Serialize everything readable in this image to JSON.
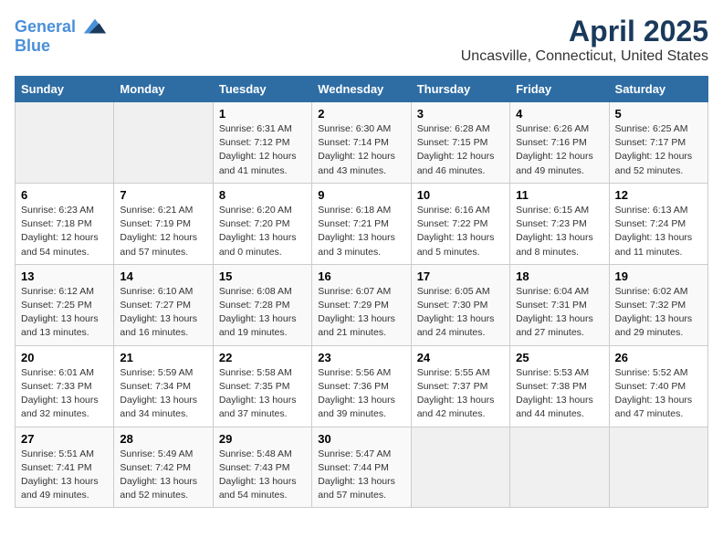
{
  "header": {
    "logo_line1": "General",
    "logo_line2": "Blue",
    "title": "April 2025",
    "subtitle": "Uncasville, Connecticut, United States"
  },
  "days_of_week": [
    "Sunday",
    "Monday",
    "Tuesday",
    "Wednesday",
    "Thursday",
    "Friday",
    "Saturday"
  ],
  "weeks": [
    [
      {
        "day": "",
        "empty": true
      },
      {
        "day": "",
        "empty": true
      },
      {
        "day": "1",
        "sunrise": "6:31 AM",
        "sunset": "7:12 PM",
        "daylight": "12 hours and 41 minutes."
      },
      {
        "day": "2",
        "sunrise": "6:30 AM",
        "sunset": "7:14 PM",
        "daylight": "12 hours and 43 minutes."
      },
      {
        "day": "3",
        "sunrise": "6:28 AM",
        "sunset": "7:15 PM",
        "daylight": "12 hours and 46 minutes."
      },
      {
        "day": "4",
        "sunrise": "6:26 AM",
        "sunset": "7:16 PM",
        "daylight": "12 hours and 49 minutes."
      },
      {
        "day": "5",
        "sunrise": "6:25 AM",
        "sunset": "7:17 PM",
        "daylight": "12 hours and 52 minutes."
      }
    ],
    [
      {
        "day": "6",
        "sunrise": "6:23 AM",
        "sunset": "7:18 PM",
        "daylight": "12 hours and 54 minutes."
      },
      {
        "day": "7",
        "sunrise": "6:21 AM",
        "sunset": "7:19 PM",
        "daylight": "12 hours and 57 minutes."
      },
      {
        "day": "8",
        "sunrise": "6:20 AM",
        "sunset": "7:20 PM",
        "daylight": "13 hours and 0 minutes."
      },
      {
        "day": "9",
        "sunrise": "6:18 AM",
        "sunset": "7:21 PM",
        "daylight": "13 hours and 3 minutes."
      },
      {
        "day": "10",
        "sunrise": "6:16 AM",
        "sunset": "7:22 PM",
        "daylight": "13 hours and 5 minutes."
      },
      {
        "day": "11",
        "sunrise": "6:15 AM",
        "sunset": "7:23 PM",
        "daylight": "13 hours and 8 minutes."
      },
      {
        "day": "12",
        "sunrise": "6:13 AM",
        "sunset": "7:24 PM",
        "daylight": "13 hours and 11 minutes."
      }
    ],
    [
      {
        "day": "13",
        "sunrise": "6:12 AM",
        "sunset": "7:25 PM",
        "daylight": "13 hours and 13 minutes."
      },
      {
        "day": "14",
        "sunrise": "6:10 AM",
        "sunset": "7:27 PM",
        "daylight": "13 hours and 16 minutes."
      },
      {
        "day": "15",
        "sunrise": "6:08 AM",
        "sunset": "7:28 PM",
        "daylight": "13 hours and 19 minutes."
      },
      {
        "day": "16",
        "sunrise": "6:07 AM",
        "sunset": "7:29 PM",
        "daylight": "13 hours and 21 minutes."
      },
      {
        "day": "17",
        "sunrise": "6:05 AM",
        "sunset": "7:30 PM",
        "daylight": "13 hours and 24 minutes."
      },
      {
        "day": "18",
        "sunrise": "6:04 AM",
        "sunset": "7:31 PM",
        "daylight": "13 hours and 27 minutes."
      },
      {
        "day": "19",
        "sunrise": "6:02 AM",
        "sunset": "7:32 PM",
        "daylight": "13 hours and 29 minutes."
      }
    ],
    [
      {
        "day": "20",
        "sunrise": "6:01 AM",
        "sunset": "7:33 PM",
        "daylight": "13 hours and 32 minutes."
      },
      {
        "day": "21",
        "sunrise": "5:59 AM",
        "sunset": "7:34 PM",
        "daylight": "13 hours and 34 minutes."
      },
      {
        "day": "22",
        "sunrise": "5:58 AM",
        "sunset": "7:35 PM",
        "daylight": "13 hours and 37 minutes."
      },
      {
        "day": "23",
        "sunrise": "5:56 AM",
        "sunset": "7:36 PM",
        "daylight": "13 hours and 39 minutes."
      },
      {
        "day": "24",
        "sunrise": "5:55 AM",
        "sunset": "7:37 PM",
        "daylight": "13 hours and 42 minutes."
      },
      {
        "day": "25",
        "sunrise": "5:53 AM",
        "sunset": "7:38 PM",
        "daylight": "13 hours and 44 minutes."
      },
      {
        "day": "26",
        "sunrise": "5:52 AM",
        "sunset": "7:40 PM",
        "daylight": "13 hours and 47 minutes."
      }
    ],
    [
      {
        "day": "27",
        "sunrise": "5:51 AM",
        "sunset": "7:41 PM",
        "daylight": "13 hours and 49 minutes."
      },
      {
        "day": "28",
        "sunrise": "5:49 AM",
        "sunset": "7:42 PM",
        "daylight": "13 hours and 52 minutes."
      },
      {
        "day": "29",
        "sunrise": "5:48 AM",
        "sunset": "7:43 PM",
        "daylight": "13 hours and 54 minutes."
      },
      {
        "day": "30",
        "sunrise": "5:47 AM",
        "sunset": "7:44 PM",
        "daylight": "13 hours and 57 minutes."
      },
      {
        "day": "",
        "empty": true
      },
      {
        "day": "",
        "empty": true
      },
      {
        "day": "",
        "empty": true
      }
    ]
  ],
  "labels": {
    "sunrise": "Sunrise:",
    "sunset": "Sunset:",
    "daylight": "Daylight:"
  }
}
